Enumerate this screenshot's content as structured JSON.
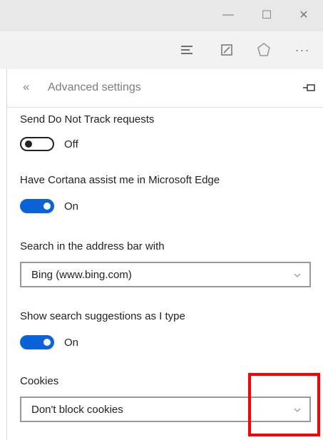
{
  "window": {
    "minimize_glyph": "—",
    "maximize_glyph": "☐",
    "close_glyph": "✕"
  },
  "toolbar": {
    "hub_icon": "hub-icon",
    "note_icon": "web-note-icon",
    "share_icon": "share-icon",
    "more_glyph": "···"
  },
  "panel": {
    "back_glyph": "«",
    "title": "Advanced settings",
    "pin_icon": "pin-icon"
  },
  "settings": {
    "dnt": {
      "label": "Send Do Not Track requests",
      "state": "Off"
    },
    "cortana": {
      "label": "Have Cortana assist me in Microsoft Edge",
      "state": "On"
    },
    "search": {
      "label": "Search in the address bar with",
      "value": "Bing (www.bing.com)"
    },
    "suggestions": {
      "label": "Show search suggestions as I type",
      "state": "On"
    },
    "cookies": {
      "label": "Cookies",
      "value": "Don't block cookies"
    }
  },
  "colors": {
    "accent": "#0a64d8",
    "highlight": "#ff0000"
  }
}
